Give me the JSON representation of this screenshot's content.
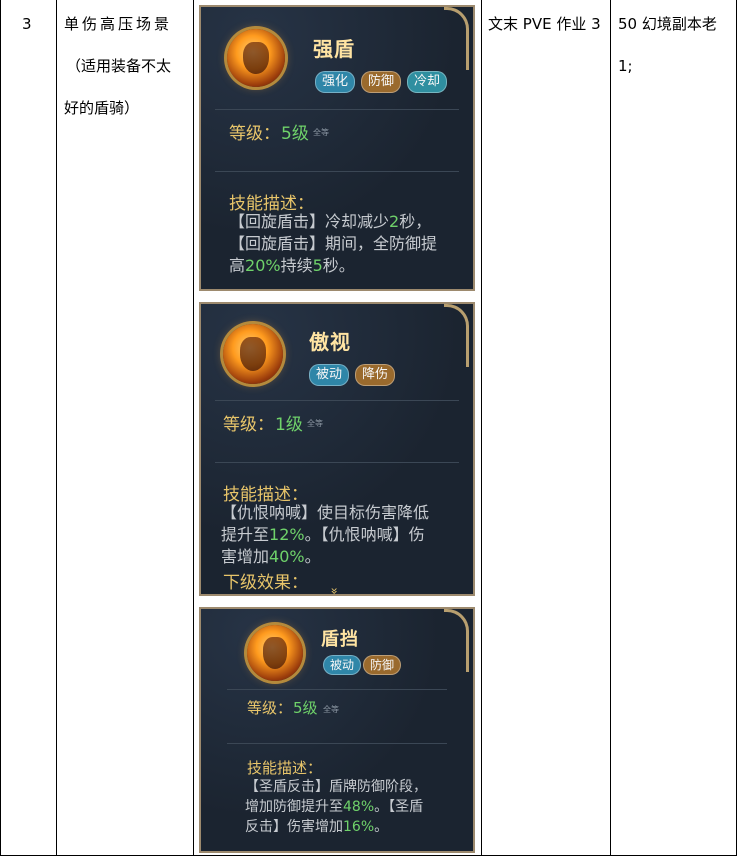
{
  "row": {
    "number": "3",
    "scenario_line1": "单伤高压场景",
    "scenario_line2": "（适用装备不太",
    "scenario_line3": "好的盾骑）",
    "source": "文末 PVE 作业 3",
    "note_line1": "50 幻境副本老",
    "note_line2": "1;"
  },
  "cards": [
    {
      "name": "强盾",
      "tags": [
        "强化",
        "防御",
        "冷却"
      ],
      "level_label": "等级：",
      "level_value": "5级",
      "level_small": "全等",
      "desc_title": "技能描述：",
      "desc_parts": [
        {
          "t": "【回旋盾击】冷却减少"
        },
        {
          "t": "2",
          "g": true
        },
        {
          "t": "秒，"
        },
        {
          "br": true
        },
        {
          "t": "【回旋盾击】期间，全防御提"
        },
        {
          "br": true
        },
        {
          "t": "高"
        },
        {
          "t": "20%",
          "g": true
        },
        {
          "t": "持续"
        },
        {
          "t": "5",
          "g": true
        },
        {
          "t": "秒。"
        }
      ]
    },
    {
      "name": "傲视",
      "tags": [
        "被动",
        "降伤"
      ],
      "level_label": "等级：",
      "level_value": "1级",
      "level_small": "全等",
      "desc_title": "技能描述：",
      "desc_parts": [
        {
          "t": "【仇恨呐喊】使目标伤害降低"
        },
        {
          "br": true
        },
        {
          "t": "提升至"
        },
        {
          "t": "12%",
          "g": true
        },
        {
          "t": "。【仇恨呐喊】伤"
        },
        {
          "br": true
        },
        {
          "t": "害增加"
        },
        {
          "t": "40%",
          "g": true
        },
        {
          "t": "。"
        }
      ],
      "next_label": "下级效果：",
      "chevron": "»"
    },
    {
      "name": "盾挡",
      "tags": [
        "被动",
        "防御"
      ],
      "level_label": "等级：",
      "level_value": "5级",
      "level_small": "全等",
      "desc_title": "技能描述：",
      "desc_parts": [
        {
          "t": "【圣盾反击】盾牌防御阶段，"
        },
        {
          "br": true
        },
        {
          "t": "增加防御提升至"
        },
        {
          "t": "48%",
          "g": true
        },
        {
          "t": "。【圣盾"
        },
        {
          "br": true
        },
        {
          "t": "反击】伤害增加"
        },
        {
          "t": "16%",
          "g": true
        },
        {
          "t": "。"
        }
      ]
    }
  ],
  "colors": {
    "card_bg": "#1b2430",
    "card_border": "#9d8a6e",
    "name": "#ffe4a3",
    "label_gold": "#e8c56a",
    "value_green": "#6fd26a",
    "tag_blue": "#2f86a8",
    "tag_gold": "#9a6a2d"
  }
}
